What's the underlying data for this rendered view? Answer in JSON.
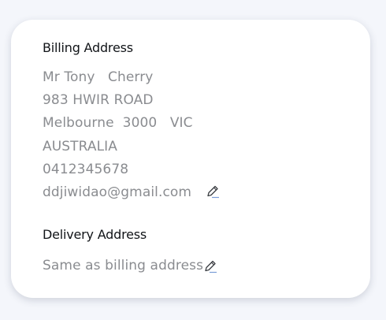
{
  "billing": {
    "title": "Billing Address",
    "name": "Mr Tony   Cherry",
    "street": "983 HWIR ROAD",
    "city_line": "Melbourne  3000   VIC",
    "country": "AUSTRALIA",
    "phone": "0412345678",
    "email": "ddjiwidao@gmail.com"
  },
  "delivery": {
    "title": "Delivery Address",
    "summary": "Same as billing address"
  },
  "icons": {
    "edit": "pencil-edit-icon"
  },
  "colors": {
    "background": "#f4f6fb",
    "card": "#ffffff",
    "heading": "#111418",
    "text": "#8a8c90"
  }
}
